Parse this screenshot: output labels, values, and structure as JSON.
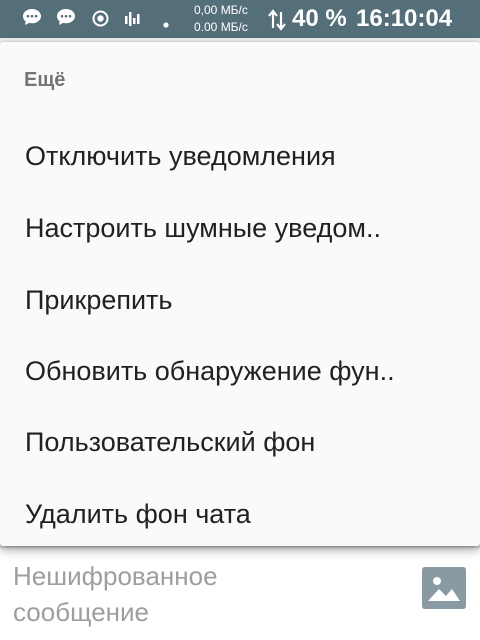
{
  "status_bar": {
    "upload_speed": "0,00 МБ/с",
    "download_speed": "0.00 МБ/с",
    "battery": "40 %",
    "time": "16:10:04",
    "icons": [
      "chat-notification-icon",
      "chat-notification-icon",
      "radio-target-icon",
      "signal-bars-icon",
      "dot-icon",
      "data-arrows-icon"
    ]
  },
  "menu": {
    "header": "Ещё",
    "items": [
      {
        "label": "Отключить уведомления"
      },
      {
        "label": "Настроить шумные уведом.."
      },
      {
        "label": "Прикрепить"
      },
      {
        "label": "Обновить обнаружение фун.."
      },
      {
        "label": "Пользовательский фон"
      },
      {
        "label": "Удалить фон чата"
      }
    ]
  },
  "chat_input": {
    "placeholder": "Нешифрованное сообщение",
    "attach_icon": "image-icon"
  },
  "colors": {
    "status_bar": "#546e7a",
    "menu_background": "#fafafa",
    "menu_text": "#212121",
    "header_text": "#757575",
    "placeholder_text": "#9e9e9e"
  }
}
